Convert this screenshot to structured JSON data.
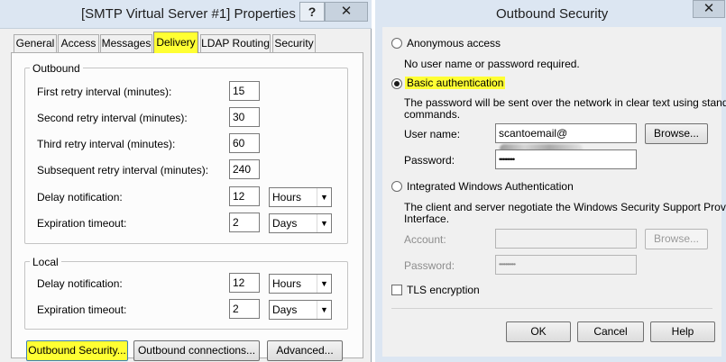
{
  "left_window": {
    "title": "[SMTP Virtual Server #1] Properties",
    "help_glyph": "?",
    "close_glyph": "✕",
    "tabs": [
      {
        "label": "General"
      },
      {
        "label": "Access"
      },
      {
        "label": "Messages"
      },
      {
        "label": "Delivery",
        "active": true
      },
      {
        "label": "LDAP Routing"
      },
      {
        "label": "Security"
      }
    ],
    "outbound": {
      "label": "Outbound",
      "first_retry": {
        "label": "First retry interval (minutes):",
        "value": "15"
      },
      "second_retry": {
        "label": "Second retry interval (minutes):",
        "value": "30"
      },
      "third_retry": {
        "label": "Third retry interval (minutes):",
        "value": "60"
      },
      "subsequent_retry": {
        "label": "Subsequent retry interval (minutes):",
        "value": "240"
      },
      "delay_notification": {
        "label": "Delay notification:",
        "value": "12",
        "unit": "Hours"
      },
      "expiration_timeout": {
        "label": "Expiration timeout:",
        "value": "2",
        "unit": "Days"
      }
    },
    "local": {
      "label": "Local",
      "delay_notification": {
        "label": "Delay notification:",
        "value": "12",
        "unit": "Hours"
      },
      "expiration_timeout": {
        "label": "Expiration timeout:",
        "value": "2",
        "unit": "Days"
      }
    },
    "buttons": {
      "outbound_security": "Outbound Security...",
      "outbound_connections": "Outbound connections...",
      "advanced": "Advanced..."
    }
  },
  "right_window": {
    "title": "Outbound Security",
    "anonymous": {
      "label": "Anonymous access",
      "desc": "No user name or password required."
    },
    "basic": {
      "label": "Basic authentication",
      "desc_line1": "The password will be sent over the network in clear text using standard",
      "desc_line2": "commands.",
      "user_name_label": "User name:",
      "user_name_value": "scantoemail@",
      "password_label": "Password:",
      "password_value": "••••••••",
      "browse": "Browse..."
    },
    "integrated": {
      "label": "Integrated Windows Authentication",
      "desc_line1": "The client and server negotiate the Windows Security Support Provider",
      "desc_line2": "Interface.",
      "account_label": "Account:",
      "password_label": "Password:",
      "password_value": "••••••••••",
      "browse": "Browse..."
    },
    "tls": {
      "label": "TLS encryption"
    },
    "buttons": {
      "ok": "OK",
      "cancel": "Cancel",
      "help": "Help"
    }
  },
  "colors": {
    "highlight": "#ffff33",
    "titlebar": "#dce6f2",
    "dialog_bg": "#f0f0f0"
  }
}
